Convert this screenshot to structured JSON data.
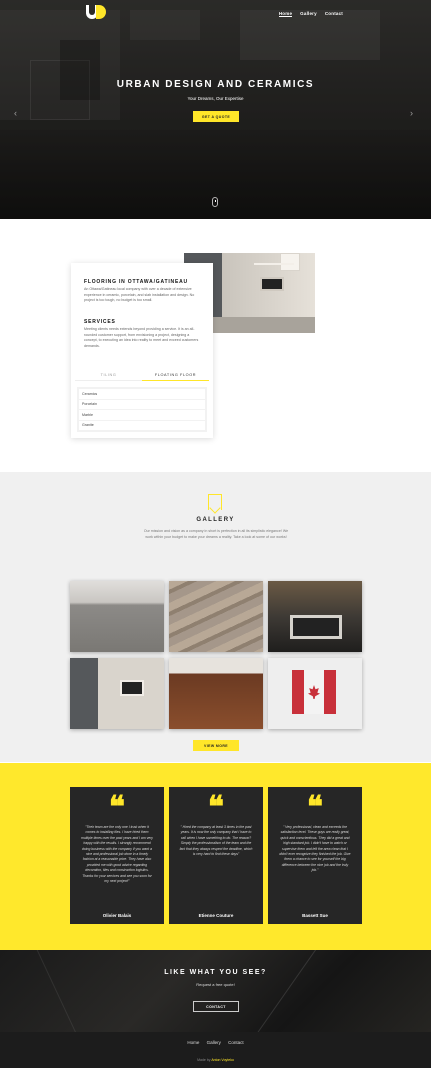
{
  "nav": {
    "items": [
      "Home",
      "Gallery",
      "Contact"
    ],
    "active": "Home"
  },
  "hero": {
    "title": "URBAN DESIGN AND CERAMICS",
    "subtitle": "Your Dreams, Our Expertise",
    "button": "GET A QUOTE"
  },
  "about": {
    "heading1": "FLOORING IN OTTAWA/GATINEAU",
    "text1": "An Ottawa/Gatineau local company with over a decade of extensive experience in ceramic, porcelain, and slab installation and design. No project is too tough, no budget is too small.",
    "heading2": "SERVICES",
    "text2": "Meeting clients needs extends beyond providing a service. It is an all-rounded customer support, from envisioning a project, designing a concept, to executing an idea into reality to meet and exceed customers demands.",
    "tabs": [
      "TILING",
      "FLOATING FLOOR"
    ],
    "active_tab": "FLOATING FLOOR",
    "list": [
      "Ceramics",
      "Porcelain",
      "Marble",
      "Granite"
    ]
  },
  "gallery": {
    "title": "GALLERY",
    "text": "Our mission and vision as a company in short is perfection in all its simplistic elegance! We work within your budget to make your dreams a reality. Take a look at some of our works!",
    "button": "VIEW MORE"
  },
  "testimonials": [
    {
      "quote": "\"Their team are the only one I trust when it comes to installing tiles. I have hired them multiple times over the past years and I am very happy with the results. I strongly recommend doing business with the company if you want a nice and professional job done in a timely fashion at a reasonable price. They have also provided me with good advice regarding decoration, tiles and construction logistics. Thanks for your services and see you soon for my next project!\"",
      "name": "Olivier Balais"
    },
    {
      "quote": "\" Hired the company at least 3 times in the past years. It is now the only company that I have to call when I have something to do. The reason? Simply the professionalism of the team and the fact that they always respect the deadline, which is very hard to find these days\"",
      "name": "Etienne Couture"
    },
    {
      "quote": "\" Very professional, clean and exceeds the satisfaction level. These guys are really great, quick and conscientious. They did a great and high standard job. I didn't have to watch or supervise them and left the area clean that I didn't ever recognize they finished the job. Give them a chance to see for yourself the big difference between the nice job and the truly job.\"",
      "name": "Bassett Sue"
    }
  ],
  "cta": {
    "title": "LIKE WHAT YOU SEE?",
    "subtitle": "Request a free quote!",
    "button": "CONTACT"
  },
  "footer": {
    "links": [
      "Home",
      "Gallery",
      "Contact"
    ],
    "made_prefix": "Made by",
    "made_by": "Anton Voyteko"
  },
  "colors": {
    "accent": "#ffe629",
    "dark": "#262626",
    "light_bg": "#f0f0f0"
  }
}
